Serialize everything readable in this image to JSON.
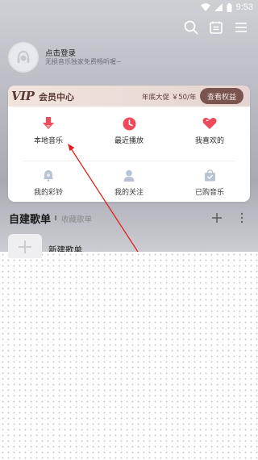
{
  "status_bar": {
    "time": "9:53"
  },
  "user": {
    "login_text": "点击登录",
    "subtitle": "无损音乐独家免费畅听喔~"
  },
  "vip": {
    "logo": "VIP",
    "title": "会员中心",
    "promo": "年底大促 ￥50/年",
    "button": "查看权益"
  },
  "grid": [
    {
      "label": "本地音乐",
      "icon": "download-icon"
    },
    {
      "label": "最近播放",
      "icon": "clock-icon"
    },
    {
      "label": "我喜欢的",
      "icon": "heart-icon"
    },
    {
      "label": "我的彩铃",
      "icon": "bell-icon"
    },
    {
      "label": "我的关注",
      "icon": "person-icon"
    },
    {
      "label": "已购音乐",
      "icon": "bag-icon"
    }
  ],
  "playlists": {
    "tab_created": "自建歌单",
    "tab_collected": "收藏歌单",
    "new_playlist": "新建歌单"
  },
  "colors": {
    "accent_red": "#ef4a5c",
    "vip_brown": "#7a5550"
  }
}
